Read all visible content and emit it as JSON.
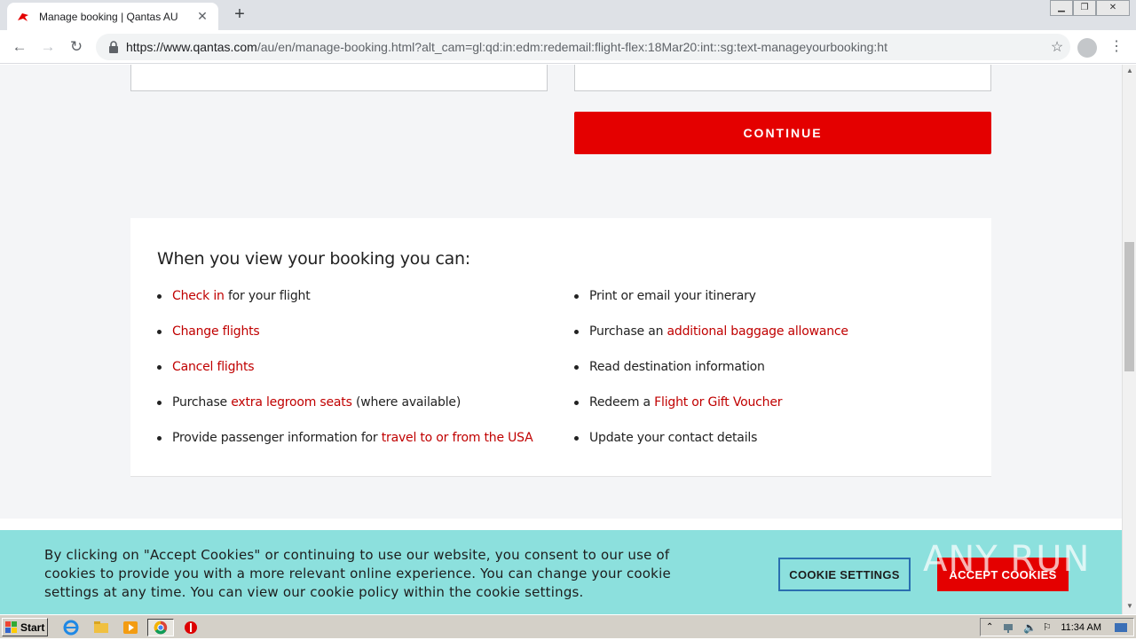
{
  "browser": {
    "tab_title": "Manage booking | Qantas AU",
    "url_host": "https://www.qantas.com",
    "url_path": "/au/en/manage-booking.html?alt_cam=gl:qd:in:edm:redemail:flight-flex:18Mar20:int::sg:text-manageyourbooking:ht"
  },
  "page": {
    "continue_label": "CONTINUE",
    "info_heading": "When you view your booking you can:",
    "left_items": [
      {
        "link": "Check in",
        "text": " for your flight",
        "pre": ""
      },
      {
        "link": "Change flights",
        "text": "",
        "pre": ""
      },
      {
        "link": "Cancel flights",
        "text": "",
        "pre": ""
      },
      {
        "pre": "Purchase ",
        "link": "extra legroom seats",
        "text": " (where available)"
      },
      {
        "pre": "Provide passenger information for ",
        "link": "travel to or from the USA",
        "text": ""
      }
    ],
    "right_items": [
      {
        "pre": "Print or email your itinerary",
        "link": "",
        "text": ""
      },
      {
        "pre": "Purchase an ",
        "link": "additional baggage allowance",
        "text": ""
      },
      {
        "pre": "Read destination information",
        "link": "",
        "text": ""
      },
      {
        "pre": "Redeem a ",
        "link": "Flight or Gift Voucher",
        "text": ""
      },
      {
        "pre": "Update your contact details",
        "link": "",
        "text": ""
      }
    ]
  },
  "cookie": {
    "text": "By clicking on \"Accept Cookies\" or continuing to use our website, you consent to our use of cookies to provide you with a more relevant online experience. You can change your cookie settings at any time. You can view our cookie policy within the cookie settings.",
    "settings_label": "COOKIE SETTINGS",
    "accept_label": "ACCEPT COOKIES"
  },
  "watermark": "ANY RUN",
  "taskbar": {
    "start_label": "Start",
    "clock": "11:34 AM"
  },
  "colors": {
    "brand_red": "#e40000",
    "link_red": "#c00000",
    "cookie_bg": "#8ce0dd"
  }
}
